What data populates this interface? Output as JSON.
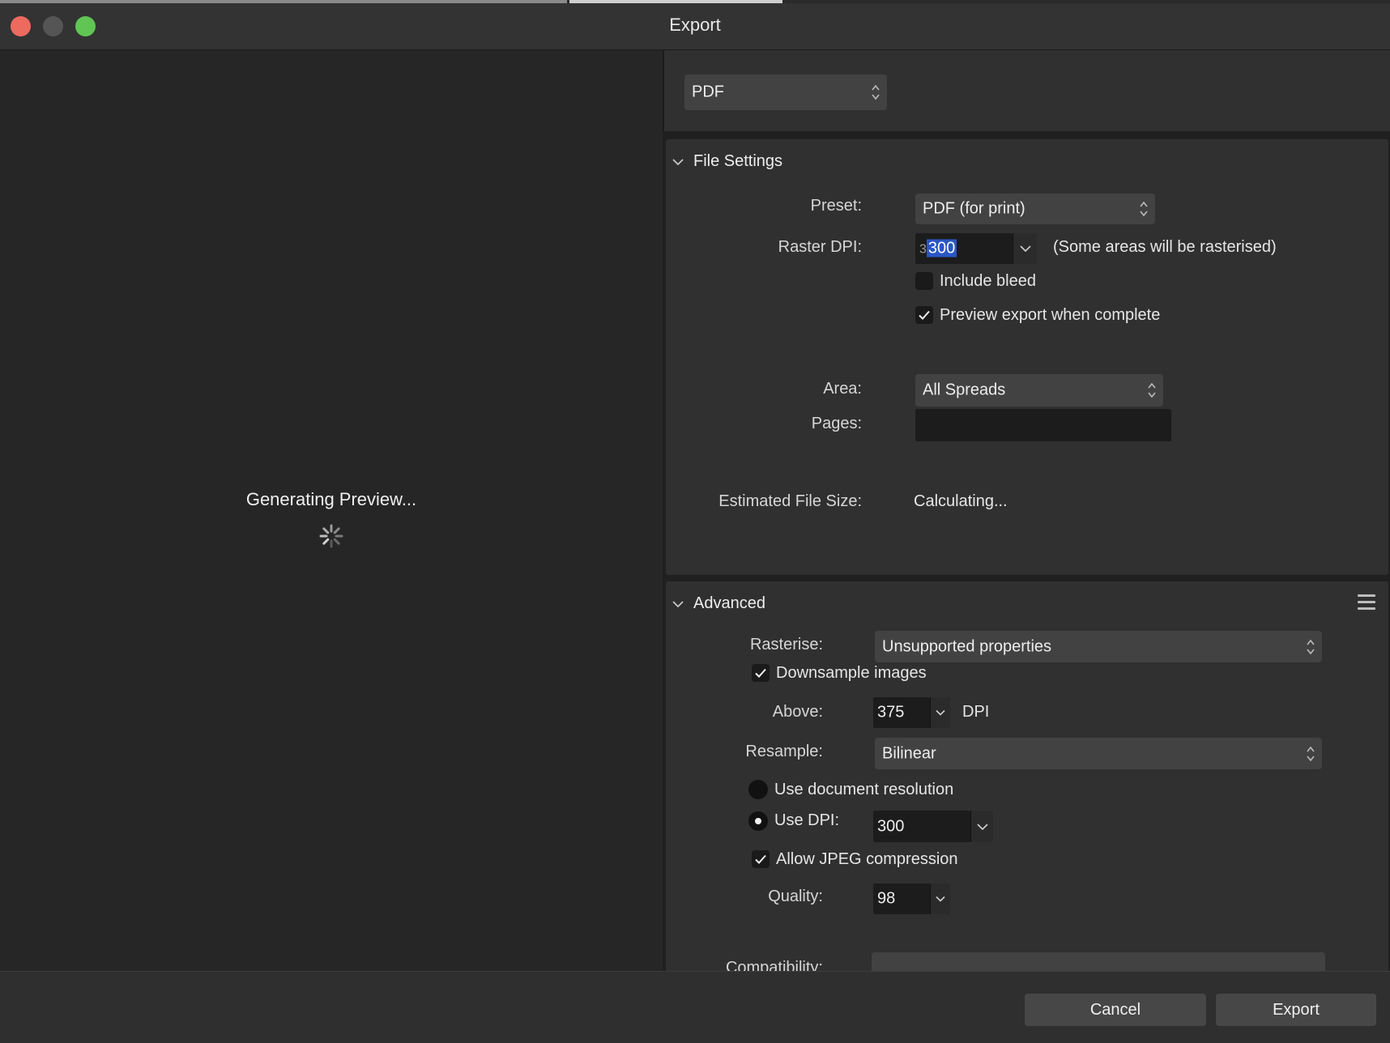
{
  "window": {
    "title": "Export"
  },
  "preview": {
    "status": "Generating Preview..."
  },
  "format": {
    "selected": "PDF"
  },
  "file_settings": {
    "header": "File Settings",
    "preset_label": "Preset:",
    "preset_value": "PDF (for print)",
    "raster_dpi_label": "Raster DPI:",
    "raster_dpi_prefix": "3",
    "raster_dpi_value": "300",
    "raster_note": "(Some areas will be rasterised)",
    "include_bleed_label": "Include bleed",
    "include_bleed_checked": false,
    "preview_export_label": "Preview export when complete",
    "preview_export_checked": true,
    "area_label": "Area:",
    "area_value": "All Spreads",
    "pages_label": "Pages:",
    "pages_value": "",
    "est_size_label": "Estimated File Size:",
    "est_size_value": "Calculating..."
  },
  "advanced": {
    "header": "Advanced",
    "rasterise_label": "Rasterise:",
    "rasterise_value": "Unsupported properties",
    "downsample_label": "Downsample images",
    "downsample_checked": true,
    "above_label": "Above:",
    "above_value": "375",
    "above_unit": "DPI",
    "resample_label": "Resample:",
    "resample_value": "Bilinear",
    "use_doc_res_label": "Use document resolution",
    "use_dpi_label": "Use DPI:",
    "use_dpi_value": "300",
    "selected_resolution_option": "Use DPI",
    "jpeg_label": "Allow JPEG compression",
    "jpeg_checked": true,
    "quality_label": "Quality:",
    "quality_value": "98",
    "compatibility_label": "Compatibility:"
  },
  "buttons": {
    "cancel": "Cancel",
    "export": "Export"
  },
  "colors": {
    "accent_selection": "#2a56c6",
    "close": "#ed6a5e",
    "maximize": "#61c554"
  }
}
